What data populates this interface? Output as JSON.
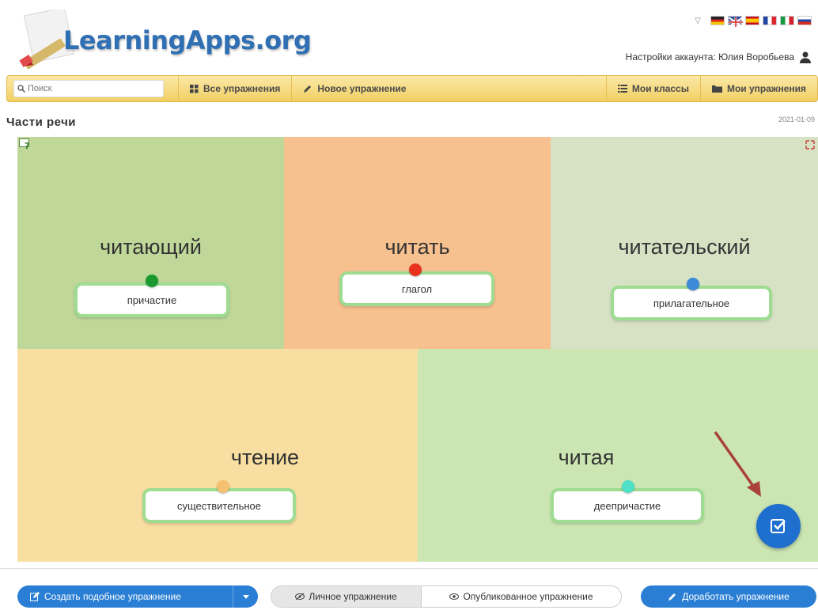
{
  "header": {
    "logo_text": "LearningApps.org",
    "account_label": "Настройки аккаунта: Юлия Воробьева",
    "languages": [
      "de",
      "en",
      "es",
      "fr",
      "it",
      "ru"
    ]
  },
  "nav": {
    "search_placeholder": "Поиск",
    "items": [
      {
        "label": "Все упражнения",
        "icon": "grid-icon"
      },
      {
        "label": "Новое упражнение",
        "icon": "pencil-icon"
      },
      {
        "label": "Мои классы",
        "icon": "list-icon"
      },
      {
        "label": "Мои упражнения",
        "icon": "folder-icon"
      }
    ],
    "color": "#f1cf63"
  },
  "page": {
    "title": "Части речи",
    "date": "2021-01-09"
  },
  "app": {
    "cells": [
      {
        "word": "читающий",
        "card": "причастие",
        "color": "#bfd89a",
        "pin": "#1a9a2e"
      },
      {
        "word": "читать",
        "card": "глагол",
        "color": "#f7c08f",
        "pin": "#e8321e"
      },
      {
        "word": "читательский",
        "card": "прилагательное",
        "color": "#d7e2c5",
        "pin": "#3a8ad8"
      },
      {
        "word": "чтение",
        "card": "существительное",
        "color": "#f8dea0",
        "pin": "#f5c070"
      },
      {
        "word": "читая",
        "card": "деепричастие",
        "color": "#cbe6b3",
        "pin": "#4fe0c8"
      }
    ],
    "check_button_icon": "check-icon"
  },
  "footer": {
    "create_similar": "Создать подобное упражнение",
    "private_label": "Личное упражнение",
    "published_label": "Опубликованное упражнение",
    "improve_label": "Доработать упражнение",
    "accent": "#2a7fd4"
  }
}
